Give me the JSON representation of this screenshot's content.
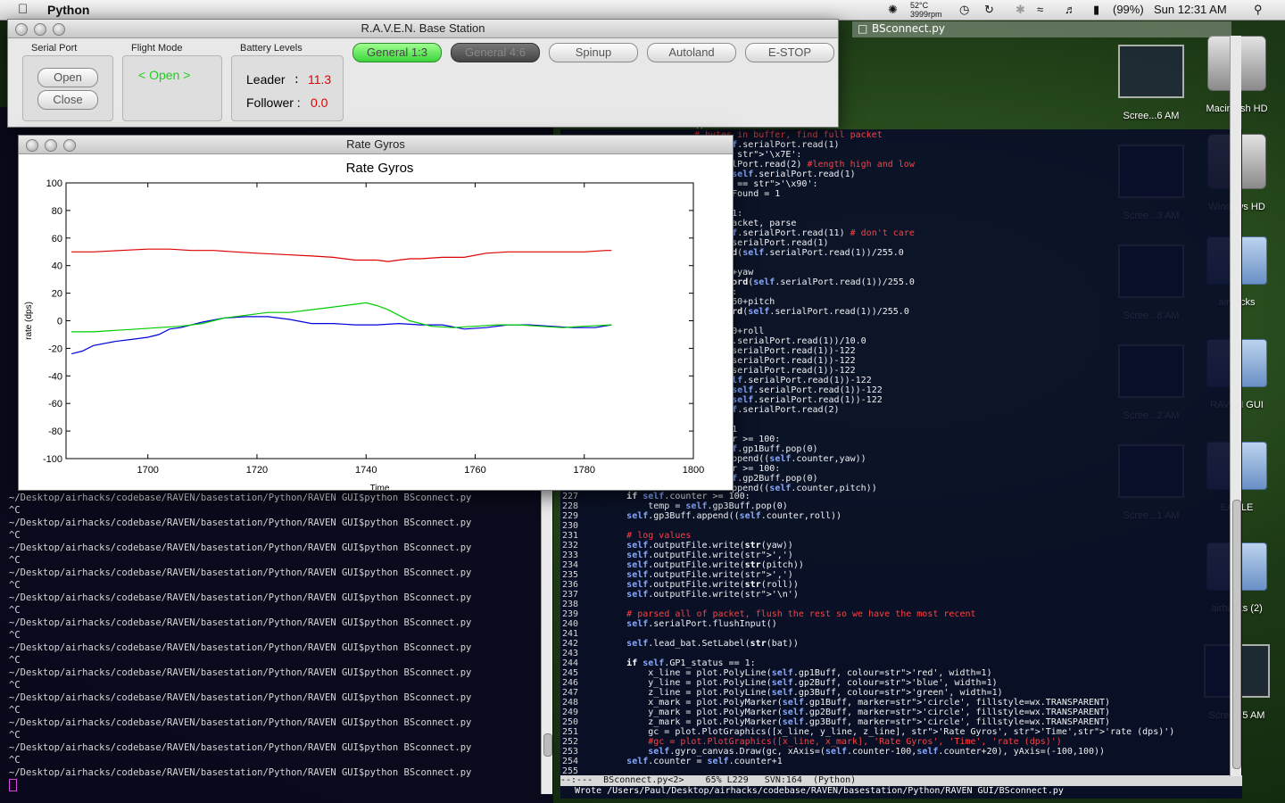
{
  "menubar": {
    "app_name": "Python",
    "temp": "52°C",
    "rpm": "3999rpm",
    "battery": "(99%)",
    "clock": "Sun 12:31 AM"
  },
  "base_station": {
    "title": "R.A.V.E.N. Base Station",
    "serial_port": {
      "label": "Serial Port",
      "open_label": "Open",
      "close_label": "Close"
    },
    "flight_mode": {
      "label": "Flight Mode",
      "value": "< Open >"
    },
    "battery": {
      "label": "Battery Levels",
      "leader_label": "Leader",
      "leader_sep": ":",
      "leader_value": "11.3",
      "follower_label": "Follower :",
      "follower_value": "0.0"
    },
    "buttons": {
      "general13": "General 1:3",
      "general46": "General 4:6",
      "spinup": "Spinup",
      "autoland": "Autoland",
      "estop": "E-STOP"
    }
  },
  "gyro_window": {
    "title": "Rate Gyros"
  },
  "chart_data": {
    "type": "line",
    "title": "Rate Gyros",
    "xlabel": "Time",
    "ylabel": "rate (dps)",
    "xlim": [
      1685,
      1800
    ],
    "ylim": [
      -100,
      100
    ],
    "xticks": [
      1700,
      1720,
      1740,
      1760,
      1780,
      1800
    ],
    "yticks": [
      100,
      80,
      60,
      40,
      20,
      0,
      -20,
      -40,
      -60,
      -80,
      -100
    ],
    "grid": false,
    "series": [
      {
        "color": "#dd0000",
        "x": [
          1686,
          1690,
          1695,
          1700,
          1704,
          1708,
          1712,
          1716,
          1720,
          1725,
          1730,
          1734,
          1738,
          1742,
          1744,
          1746,
          1748,
          1750,
          1754,
          1758,
          1762,
          1766,
          1770,
          1775,
          1780,
          1784,
          1785
        ],
        "y": [
          50,
          50,
          51,
          52,
          52,
          51,
          51,
          50,
          49,
          48,
          47,
          46,
          44,
          44,
          43,
          44,
          45,
          45,
          46,
          46,
          49,
          50,
          50,
          50,
          50,
          51,
          51
        ]
      },
      {
        "color": "#0000dd",
        "x": [
          1686,
          1688,
          1690,
          1694,
          1698,
          1700,
          1702,
          1704,
          1706,
          1710,
          1714,
          1718,
          1722,
          1726,
          1730,
          1734,
          1738,
          1742,
          1746,
          1750,
          1754,
          1758,
          1762,
          1766,
          1770,
          1774,
          1778,
          1782,
          1785
        ],
        "y": [
          -24,
          -22,
          -18,
          -15,
          -13,
          -12,
          -10,
          -6,
          -5,
          -1,
          2,
          3,
          3,
          1,
          -2,
          -2,
          -3,
          -3,
          -2,
          -3,
          -3,
          -6,
          -5,
          -3,
          -3,
          -4,
          -5,
          -5,
          -3
        ]
      },
      {
        "color": "#00cc00",
        "x": [
          1686,
          1690,
          1694,
          1698,
          1702,
          1706,
          1710,
          1714,
          1718,
          1722,
          1726,
          1730,
          1734,
          1738,
          1740,
          1742,
          1744,
          1746,
          1748,
          1752,
          1756,
          1760,
          1764,
          1768,
          1772,
          1776,
          1780,
          1785
        ],
        "y": [
          -8,
          -8,
          -7,
          -6,
          -5,
          -4,
          -2,
          2,
          4,
          6,
          6,
          8,
          10,
          12,
          13,
          11,
          8,
          4,
          0,
          -4,
          -5,
          -4,
          -3,
          -3,
          -4,
          -5,
          -4,
          -3
        ]
      }
    ]
  },
  "terminal": {
    "prompt_lines": [
      "~/Desktop/airhacks/codebase/RAVEN/basestation/Python/RAVEN GUI$python BSconnect.py",
      "^C",
      "~/Desktop/airhacks/codebase/RAVEN/basestation/Python/RAVEN GUI$python BSconnect.py",
      "^C",
      "~/Desktop/airhacks/codebase/RAVEN/basestation/Python/RAVEN GUI$python BSconnect.py",
      "^C",
      "~/Desktop/airhacks/codebase/RAVEN/basestation/Python/RAVEN GUI$python BSconnect.py",
      "^C",
      "~/Desktop/airhacks/codebase/RAVEN/basestation/Python/RAVEN GUI$python BSconnect.py",
      "^C",
      "~/Desktop/airhacks/codebase/RAVEN/basestation/Python/RAVEN GUI$python BSconnect.py",
      "^C",
      "~/Desktop/airhacks/codebase/RAVEN/basestation/Python/RAVEN GUI$python BSconnect.py",
      "^C",
      "~/Desktop/airhacks/codebase/RAVEN/basestation/Python/RAVEN GUI$python BSconnect.py",
      "^C",
      "~/Desktop/airhacks/codebase/RAVEN/basestation/Python/RAVEN GUI$python BSconnect.py",
      "^C",
      "~/Desktop/airhacks/codebase/RAVEN/basestation/Python/RAVEN GUI$python BSconnect.py",
      "^C",
      "~/Desktop/airhacks/codebase/RAVEN/basestation/Python/RAVEN GUI$python BSconnect.py",
      "^C",
      "~/Desktop/airhacks/codebase/RAVEN/basestation/Python/RAVEN GUI$python BSconnect.py"
    ]
  },
  "emacs": {
    "title": "BSconnect.py",
    "code_lines": [
      {
        "n": "227",
        "t": "        if self.counter >= 100:"
      },
      {
        "n": "228",
        "t": "            temp = self.gp3Buff.pop(0)"
      },
      {
        "n": "229",
        "t": "        self.gp3Buff.append((self.counter,roll))"
      },
      {
        "n": "230",
        "t": ""
      },
      {
        "n": "231",
        "t": "        # log values"
      },
      {
        "n": "232",
        "t": "        self.outputFile.write(str(yaw))"
      },
      {
        "n": "233",
        "t": "        self.outputFile.write(',')"
      },
      {
        "n": "234",
        "t": "        self.outputFile.write(str(pitch))"
      },
      {
        "n": "235",
        "t": "        self.outputFile.write(',')"
      },
      {
        "n": "236",
        "t": "        self.outputFile.write(str(roll))"
      },
      {
        "n": "237",
        "t": "        self.outputFile.write('\\n')"
      },
      {
        "n": "238",
        "t": ""
      },
      {
        "n": "239",
        "t": "        # parsed all of packet, flush the rest so we have the most recent"
      },
      {
        "n": "240",
        "t": "        self.serialPort.flushInput()"
      },
      {
        "n": "241",
        "t": ""
      },
      {
        "n": "242",
        "t": "        self.lead_bat.SetLabel(str(bat))"
      },
      {
        "n": "243",
        "t": ""
      },
      {
        "n": "244",
        "t": "        if self.GP1_status == 1:"
      },
      {
        "n": "245",
        "t": "            x_line = plot.PolyLine(self.gp1Buff, colour='red', width=1)"
      },
      {
        "n": "246",
        "t": "            y_line = plot.PolyLine(self.gp2Buff, colour='blue', width=1)"
      },
      {
        "n": "247",
        "t": "            z_line = plot.PolyLine(self.gp3Buff, colour='green', width=1)"
      },
      {
        "n": "248",
        "t": "            x_mark = plot.PolyMarker(self.gp1Buff, marker='circle', fillstyle=wx.TRANSPARENT)"
      },
      {
        "n": "249",
        "t": "            y_mark = plot.PolyMarker(self.gp2Buff, marker='circle', fillstyle=wx.TRANSPARENT)"
      },
      {
        "n": "250",
        "t": "            z_mark = plot.PolyMarker(self.gp3Buff, marker='circle', fillstyle=wx.TRANSPARENT)"
      },
      {
        "n": "251",
        "t": "            gc = plot.PlotGraphics([x_line, y_line, z_line], 'Rate Gyros', 'Time','rate (dps)')"
      },
      {
        "n": "252",
        "t": "            #gc = plot.PlotGraphics([x_line, x_mark], 'Rate Gyros', 'Time', 'rate (dps)')"
      },
      {
        "n": "253",
        "t": "            self.gyro_canvas.Draw(gc, xAxis=(self.counter-100,self.counter+20), yAxis=(-100,100))"
      },
      {
        "n": "254",
        "t": "        self.counter = self.counter+1"
      },
      {
        "n": "255",
        "t": ""
      }
    ],
    "upper_lines": [
      "() > 0:",
      "# bytes in buffer, find full packet",
      "e = self.serialPort.read(1)",
      "Byte == '\\x7E':",
      "f.serialPort.read(2) #length high and low",
      "ketT = self.serialPort.read(1)",
      "packetT == '\\x90':",
      " packetFound = 1",
      " break",
      "und == 1:",
      "und a packet, parse",
      "e = self.serialPort.read(11) # don't care",
      "= self.serialPort.read(1)",
      "60.0*ord(self.serialPort.read(1))/255.0",
      "> 180:",
      " = -360+yaw",
      " 360.0*ord(self.serialPort.read(1))/255.0",
      "h > 180:",
      "ch = -360+pitch",
      "360.0*ord(self.serialPort.read(1))/255.0",
      " > 180:",
      "l = -360+roll",
      "rd(self.serialPort.read(1))/10.0",
      "d(self.serialPort.read(1))-122",
      "d(self.serialPort.read(1))-122",
      "d(self.serialPort.read(1))-122",
      " ord(self.serialPort.read(1))-122",
      " = ord(self.serialPort.read(1))-122",
      " = ord(self.serialPort.read(1))-122",
      "e = self.serialPort.read(2)",
      "",
      "g Plot 1",
      ".counter >= 100:",
      "p = self.gp1Buff.pop(0)",
      "1Buff.append((self.counter,yaw))",
      ".counter >= 100:",
      "p = self.gp2Buff.pop(0)",
      "2Buff.append((self.counter,pitch))"
    ],
    "modeline": "--:---  BSconnect.py<2>    65% L229   SVN:164  (Python)",
    "minibuffer": " Wrote /Users/Paul/Desktop/airhacks/codebase/RAVEN/basestation/Python/RAVEN GUI/BSconnect.py"
  },
  "desktop": {
    "icons": [
      "Scree...6 AM",
      "Macintosh HD",
      "Scree...3 AM",
      "Windows HD",
      "Scree...8 AM",
      "airhacks",
      "Scree...2 AM",
      "RAVEN GUI",
      "Scree...1 AM",
      "EAGLE",
      "airhacks (2)",
      "Scree...5 AM"
    ]
  }
}
